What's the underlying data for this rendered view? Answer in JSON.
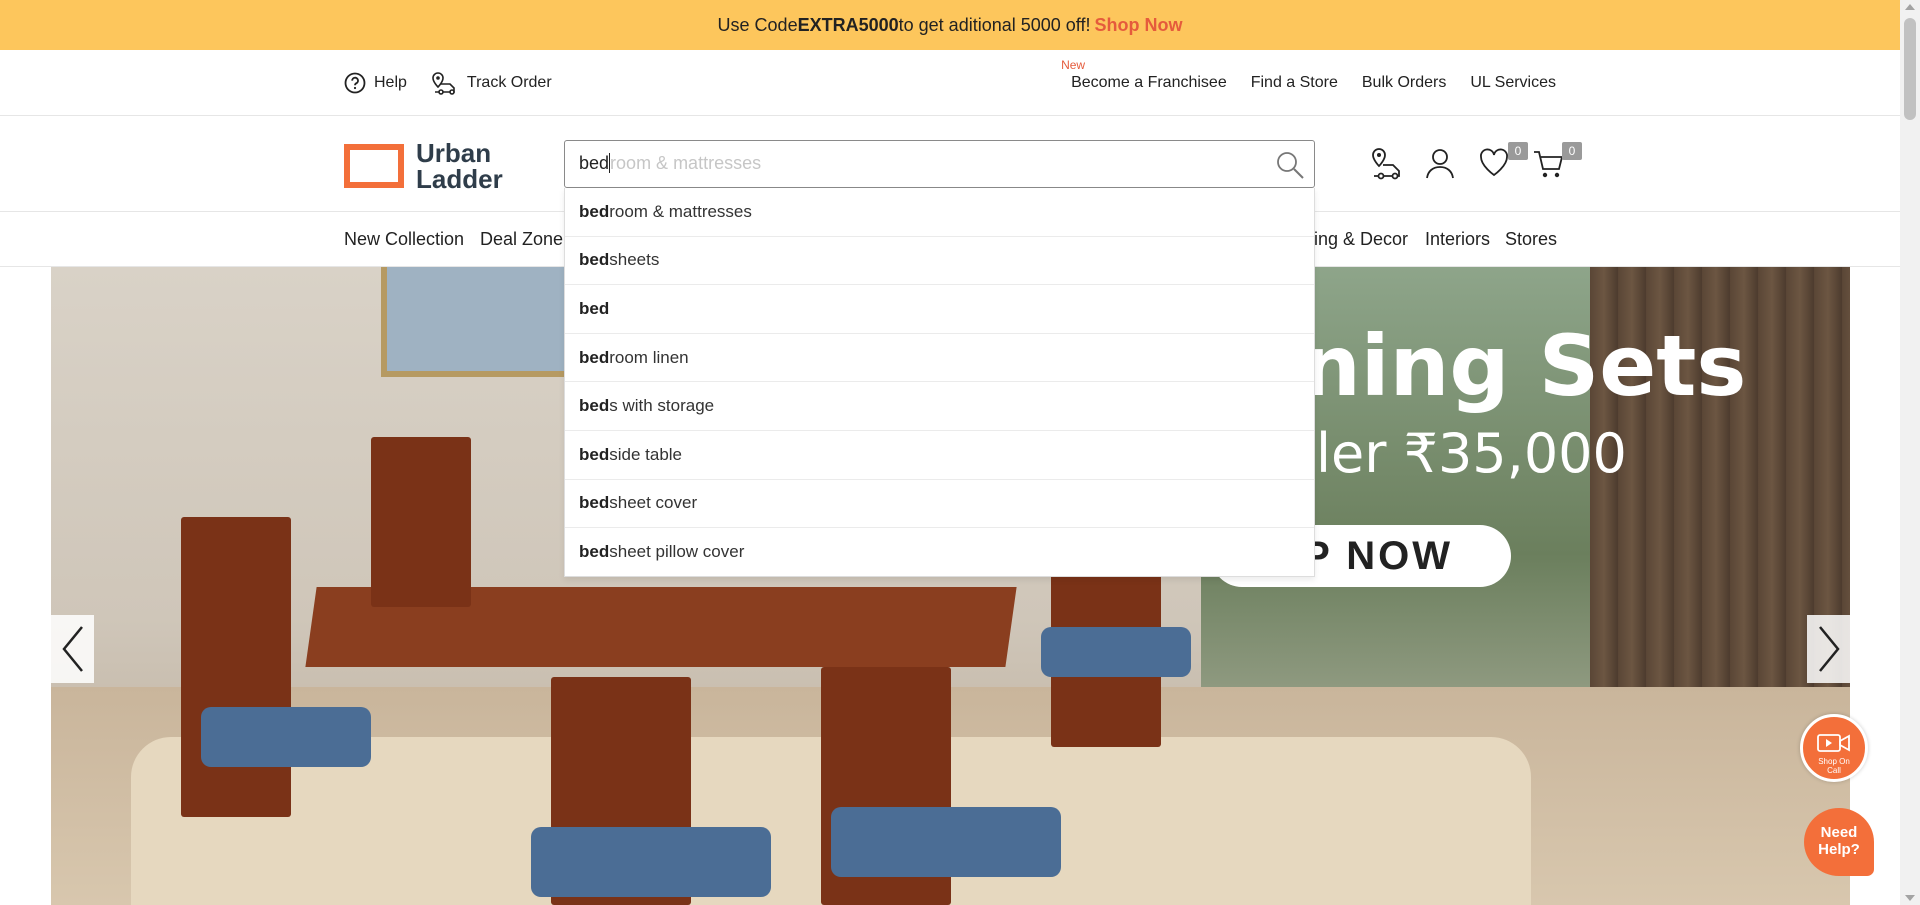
{
  "promo": {
    "prefix": "Use Code ",
    "code": "EXTRA5000",
    "middle": " to get aditional 5000 off!",
    "cta": "Shop Now"
  },
  "util": {
    "help": "Help",
    "track_order": "Track Order",
    "new_tag": "New",
    "franchise": "Become a Franchisee",
    "find_store": "Find a Store",
    "bulk_orders": "Bulk Orders",
    "ul_services": "UL Services"
  },
  "logo": {
    "line1": "Urban",
    "line2": "Ladder"
  },
  "search": {
    "typed": "bed",
    "ghost": "room & mattresses"
  },
  "header": {
    "wishlist_count": "0",
    "cart_count": "0"
  },
  "nav": {
    "new_collection": "New Collection",
    "deal_zone": "Deal Zone",
    "decor": "ing & Decor",
    "interiors": "Interiors",
    "stores": "Stores"
  },
  "suggestions": [
    {
      "match": "bed",
      "rest": "room & mattresses"
    },
    {
      "match": "bed",
      "rest": "sheets"
    },
    {
      "match": "bed",
      "rest": ""
    },
    {
      "match": "bed",
      "rest": "room linen"
    },
    {
      "match": "bed",
      "rest": "s with storage"
    },
    {
      "match": "bed",
      "rest": "side table"
    },
    {
      "match": "bed",
      "rest": "sheet cover"
    },
    {
      "match": "bed",
      "rest": "sheet pillow cover"
    }
  ],
  "hero": {
    "headline": "ning Sets",
    "subline": "ler ₹35,000",
    "cta": "OP NOW"
  },
  "floating": {
    "shop_on_call": "Shop On Call",
    "need_help": "Need Help?"
  },
  "colors": {
    "promo_bg": "#fdc65c",
    "accent": "#e55b3c",
    "floating": "#f36f3a"
  }
}
